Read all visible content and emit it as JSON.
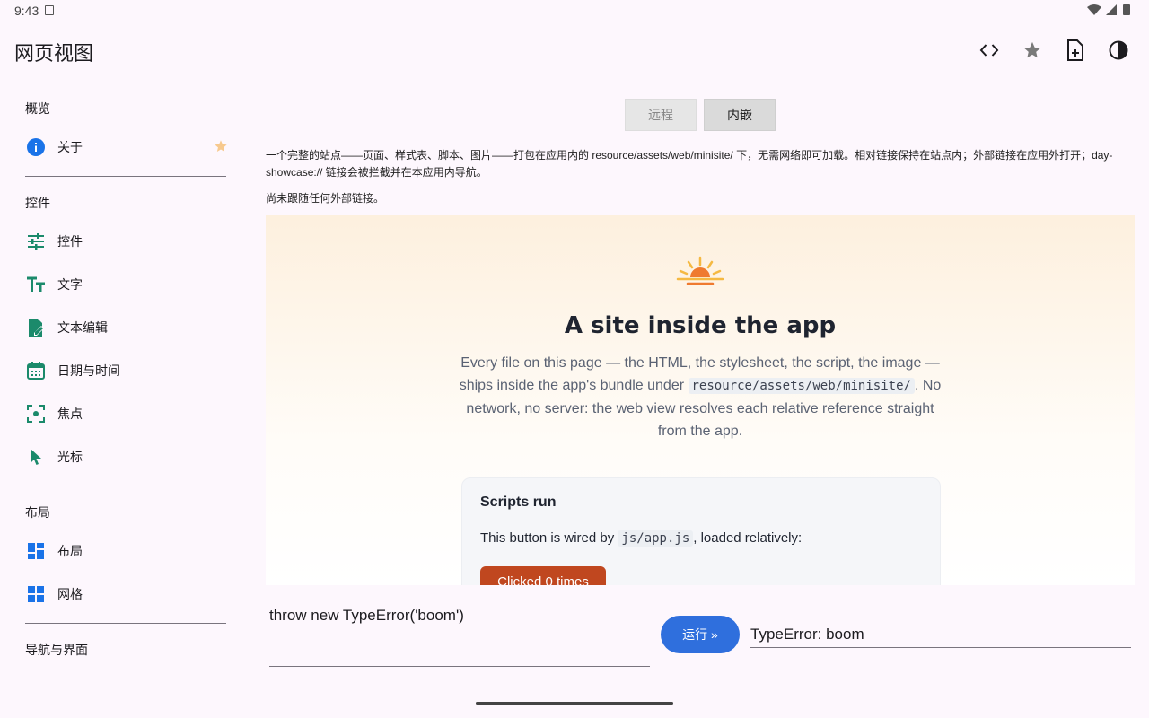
{
  "status": {
    "time": "9:43",
    "indicators": "▾◢▮"
  },
  "appbar": {
    "title": "网页视图",
    "icons": [
      "code-icon",
      "star-icon",
      "note-add-icon",
      "contrast-icon"
    ]
  },
  "sidebar": {
    "sections": [
      {
        "title": "概览",
        "items": [
          {
            "label": "关于",
            "icon": "info-icon",
            "color": "#1a73e8",
            "starred": true
          }
        ]
      },
      {
        "title": "控件",
        "items": [
          {
            "label": "控件",
            "icon": "tune-icon",
            "color": "#1b8a6b"
          },
          {
            "label": "文字",
            "icon": "text-fields-icon",
            "color": "#1b8a6b"
          },
          {
            "label": "文本编辑",
            "icon": "edit-document-icon",
            "color": "#1b8a6b"
          },
          {
            "label": "日期与时间",
            "icon": "calendar-icon",
            "color": "#1b8a6b"
          },
          {
            "label": "焦点",
            "icon": "focus-icon",
            "color": "#1b8a6b"
          },
          {
            "label": "光标",
            "icon": "cursor-icon",
            "color": "#1b8a6b"
          }
        ]
      },
      {
        "title": "布局",
        "items": [
          {
            "label": "布局",
            "icon": "dashboard-icon",
            "color": "#1a73e8"
          },
          {
            "label": "网格",
            "icon": "grid-icon",
            "color": "#1a73e8"
          }
        ]
      },
      {
        "title": "导航与界面",
        "items": []
      }
    ]
  },
  "segmented": {
    "remote": "远程",
    "embedded": "内嵌",
    "selected": "embedded"
  },
  "description": "一个完整的站点——页面、样式表、脚本、图片——打包在应用内的 resource/assets/web/minisite/ 下，无需网络即可加载。相对链接保持在站点内；外部链接在应用外打开；day-showcase:// 链接会被拦截并在本应用内导航。",
  "note": "尚未跟随任何外部链接。",
  "webpage": {
    "heading": "A site inside the app",
    "lede_part1": "Every file on this page — the HTML, the stylesheet, the script, the image — ships inside the app's bundle under ",
    "lede_code": "resource/assets/web/minisite/",
    "lede_part2": ". No network, no server: the web view resolves each relative reference straight from the app.",
    "card": {
      "title": "Scripts run",
      "text_before": "This button is wired by ",
      "code": "js/app.js",
      "text_after": ", loaded relatively:",
      "button": "Clicked 0 times"
    }
  },
  "console": {
    "command": "throw new TypeError('boom')",
    "run_label": "运行 »",
    "result": "TypeError: boom"
  }
}
